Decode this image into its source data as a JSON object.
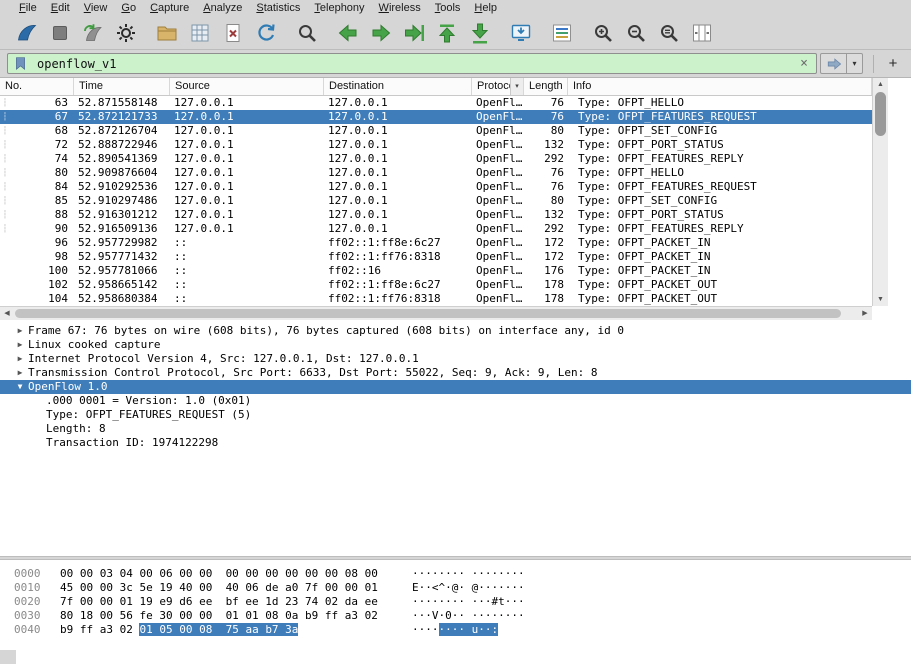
{
  "colors": {
    "selection": "#3e7db9",
    "filter_valid_bg": "#ccf2cc"
  },
  "menu": {
    "items": [
      "File",
      "Edit",
      "View",
      "Go",
      "Capture",
      "Analyze",
      "Statistics",
      "Telephony",
      "Wireless",
      "Tools",
      "Help"
    ]
  },
  "toolbar": {
    "icons": [
      "start-capture",
      "stop-capture",
      "restart-capture",
      "capture-options",
      "open-file",
      "save-file",
      "close-file",
      "reload-file",
      "find-packet",
      "go-back",
      "go-forward",
      "go-to-packet",
      "go-first",
      "go-last",
      "auto-scroll",
      "colorize",
      "zoom-in",
      "zoom-out",
      "zoom-original",
      "resize-columns"
    ]
  },
  "filter": {
    "value": "openflow_v1",
    "clear_icon": "×",
    "dropdown_icon": "▾",
    "add_label": "+"
  },
  "packet_list": {
    "columns": [
      "No.",
      "Time",
      "Source",
      "Destination",
      "Protocol",
      "Length",
      "Info"
    ],
    "rows": [
      {
        "no": "63",
        "time": "52.871558148",
        "src": "127.0.0.1",
        "dst": "127.0.0.1",
        "proto": "OpenFl…",
        "len": "76",
        "info": "Type: OFPT_HELLO",
        "selected": false,
        "related": true
      },
      {
        "no": "67",
        "time": "52.872121733",
        "src": "127.0.0.1",
        "dst": "127.0.0.1",
        "proto": "OpenFl…",
        "len": "76",
        "info": "Type: OFPT_FEATURES_REQUEST",
        "selected": true,
        "related": true
      },
      {
        "no": "68",
        "time": "52.872126704",
        "src": "127.0.0.1",
        "dst": "127.0.0.1",
        "proto": "OpenFl…",
        "len": "80",
        "info": "Type: OFPT_SET_CONFIG",
        "selected": false,
        "related": true
      },
      {
        "no": "72",
        "time": "52.888722946",
        "src": "127.0.0.1",
        "dst": "127.0.0.1",
        "proto": "OpenFl…",
        "len": "132",
        "info": "Type: OFPT_PORT_STATUS",
        "selected": false,
        "related": true
      },
      {
        "no": "74",
        "time": "52.890541369",
        "src": "127.0.0.1",
        "dst": "127.0.0.1",
        "proto": "OpenFl…",
        "len": "292",
        "info": "Type: OFPT_FEATURES_REPLY",
        "selected": false,
        "related": true
      },
      {
        "no": "80",
        "time": "52.909876604",
        "src": "127.0.0.1",
        "dst": "127.0.0.1",
        "proto": "OpenFl…",
        "len": "76",
        "info": "Type: OFPT_HELLO",
        "selected": false,
        "related": true
      },
      {
        "no": "84",
        "time": "52.910292536",
        "src": "127.0.0.1",
        "dst": "127.0.0.1",
        "proto": "OpenFl…",
        "len": "76",
        "info": "Type: OFPT_FEATURES_REQUEST",
        "selected": false,
        "related": true
      },
      {
        "no": "85",
        "time": "52.910297486",
        "src": "127.0.0.1",
        "dst": "127.0.0.1",
        "proto": "OpenFl…",
        "len": "80",
        "info": "Type: OFPT_SET_CONFIG",
        "selected": false,
        "related": true
      },
      {
        "no": "88",
        "time": "52.916301212",
        "src": "127.0.0.1",
        "dst": "127.0.0.1",
        "proto": "OpenFl…",
        "len": "132",
        "info": "Type: OFPT_PORT_STATUS",
        "selected": false,
        "related": true
      },
      {
        "no": "90",
        "time": "52.916509136",
        "src": "127.0.0.1",
        "dst": "127.0.0.1",
        "proto": "OpenFl…",
        "len": "292",
        "info": "Type: OFPT_FEATURES_REPLY",
        "selected": false,
        "related": true
      },
      {
        "no": "96",
        "time": "52.957729982",
        "src": "::",
        "dst": "ff02::1:ff8e:6c27",
        "proto": "OpenFl…",
        "len": "172",
        "info": "Type: OFPT_PACKET_IN",
        "selected": false,
        "related": false
      },
      {
        "no": "98",
        "time": "52.957771432",
        "src": "::",
        "dst": "ff02::1:ff76:8318",
        "proto": "OpenFl…",
        "len": "172",
        "info": "Type: OFPT_PACKET_IN",
        "selected": false,
        "related": false
      },
      {
        "no": "100",
        "time": "52.957781066",
        "src": "::",
        "dst": "ff02::16",
        "proto": "OpenFl…",
        "len": "176",
        "info": "Type: OFPT_PACKET_IN",
        "selected": false,
        "related": false
      },
      {
        "no": "102",
        "time": "52.958665142",
        "src": "::",
        "dst": "ff02::1:ff8e:6c27",
        "proto": "OpenFl…",
        "len": "178",
        "info": "Type: OFPT_PACKET_OUT",
        "selected": false,
        "related": false
      },
      {
        "no": "104",
        "time": "52.958680384",
        "src": "::",
        "dst": "ff02::1:ff76:8318",
        "proto": "OpenFl…",
        "len": "178",
        "info": "Type: OFPT_PACKET_OUT",
        "selected": false,
        "related": false
      }
    ]
  },
  "details": {
    "rows": [
      {
        "expander": "collapsed",
        "text": "Frame 67: 76 bytes on wire (608 bits), 76 bytes captured (608 bits) on interface any, id 0",
        "indent": 0,
        "selected": false
      },
      {
        "expander": "collapsed",
        "text": "Linux cooked capture",
        "indent": 0,
        "selected": false
      },
      {
        "expander": "collapsed",
        "text": "Internet Protocol Version 4, Src: 127.0.0.1, Dst: 127.0.0.1",
        "indent": 0,
        "selected": false
      },
      {
        "expander": "collapsed",
        "text": "Transmission Control Protocol, Src Port: 6633, Dst Port: 55022, Seq: 9, Ack: 9, Len: 8",
        "indent": 0,
        "selected": false
      },
      {
        "expander": "expanded",
        "text": "OpenFlow 1.0",
        "indent": 0,
        "selected": true
      },
      {
        "expander": "",
        "text": ".000 0001 = Version: 1.0 (0x01)",
        "indent": 1,
        "selected": false
      },
      {
        "expander": "",
        "text": "Type: OFPT_FEATURES_REQUEST (5)",
        "indent": 1,
        "selected": false
      },
      {
        "expander": "",
        "text": "Length: 8",
        "indent": 1,
        "selected": false
      },
      {
        "expander": "",
        "text": "Transaction ID: 1974122298",
        "indent": 1,
        "selected": false
      }
    ]
  },
  "hex": {
    "rows": [
      {
        "offset": "0000",
        "hex": "00 00 03 04 00 06 00 00  00 00 00 00 00 00 08 00",
        "hex_hl": "",
        "ascii": "········ ········",
        "ascii_hl": ""
      },
      {
        "offset": "0010",
        "hex": "45 00 00 3c 5e 19 40 00  40 06 de a0 7f 00 00 01",
        "hex_hl": "",
        "ascii": "E··<^·@· @·······",
        "ascii_hl": ""
      },
      {
        "offset": "0020",
        "hex": "7f 00 00 01 19 e9 d6 ee  bf ee 1d 23 74 02 da ee",
        "hex_hl": "",
        "ascii": "········ ···#t···",
        "ascii_hl": ""
      },
      {
        "offset": "0030",
        "hex": "80 18 00 56 fe 30 00 00  01 01 08 0a b9 ff a3 02",
        "hex_hl": "",
        "ascii": "···V·0·· ········",
        "ascii_hl": ""
      },
      {
        "offset": "0040",
        "hex": "b9 ff a3 02 ",
        "hex_hl": "01 05 00 08  75 aa b7 3a",
        "ascii": "····",
        "ascii_hl": "···· u··:"
      }
    ]
  }
}
